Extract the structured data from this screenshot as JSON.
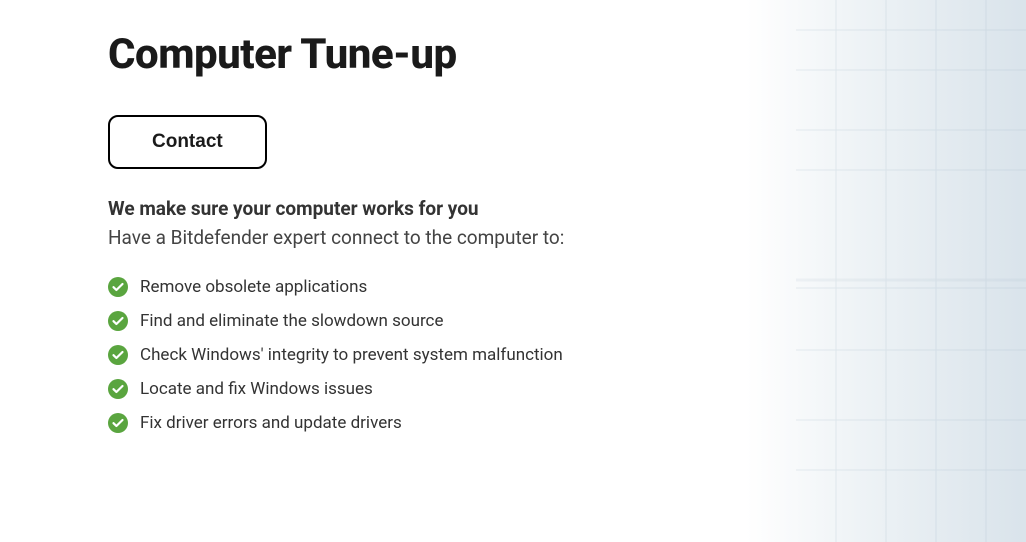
{
  "title": "Computer Tune-up",
  "contact_button": "Contact",
  "subtitle_bold": "We make sure your computer works for you",
  "subtitle_text": "Have a Bitdefender expert connect to the computer to:",
  "features": [
    "Remove obsolete applications",
    "Find and eliminate the slowdown source",
    "Check Windows' integrity to prevent system malfunction",
    "Locate and fix Windows issues",
    "Fix driver errors and update drivers"
  ],
  "colors": {
    "check_green": "#5aa53f"
  }
}
